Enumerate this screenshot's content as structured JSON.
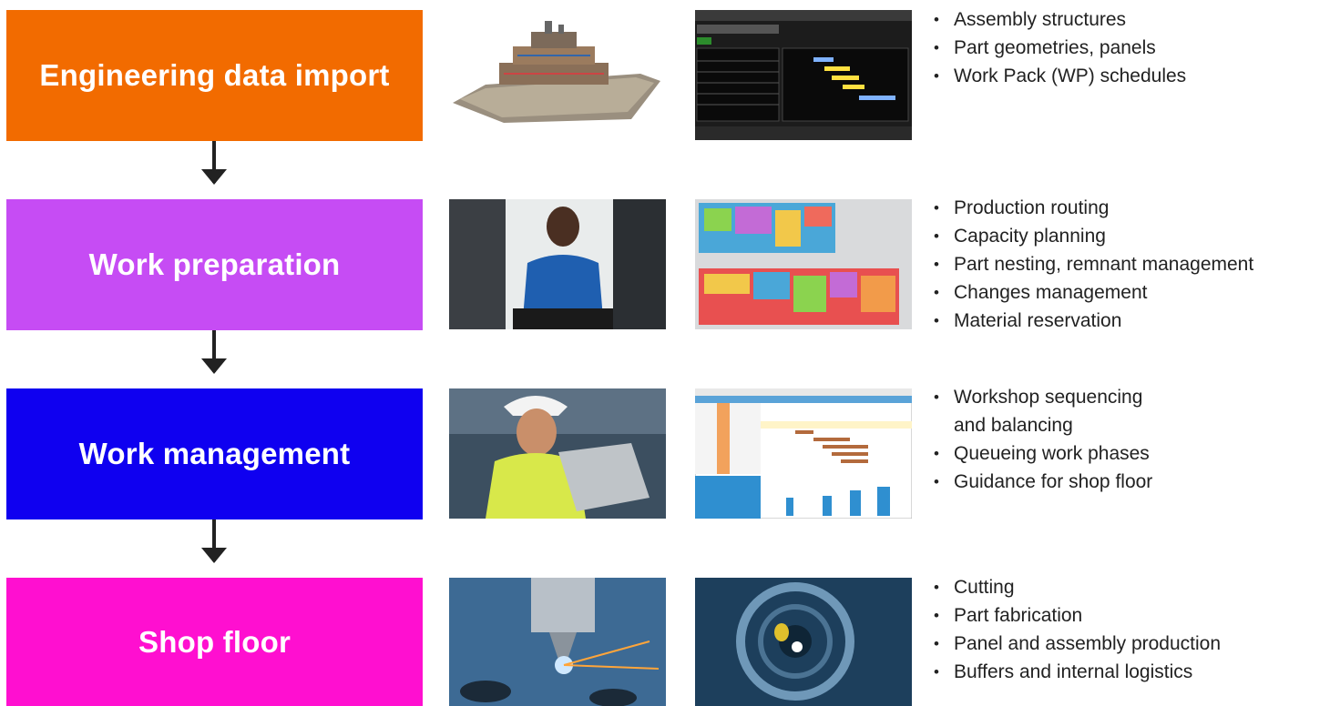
{
  "colors": {
    "stage1": "#f26b00",
    "stage2": "#c64cf4",
    "stage3": "#0f00f0",
    "stage4": "#ff0fd0"
  },
  "stages": [
    {
      "label": "Engineering data import",
      "bullets": [
        "Assembly structures",
        "Part geometries, panels",
        "Work Pack (WP) schedules"
      ]
    },
    {
      "label": "Work preparation",
      "bullets": [
        "Production routing",
        "Capacity planning",
        "Part nesting, remnant management",
        "Changes management",
        "Material reservation"
      ]
    },
    {
      "label": "Work management",
      "bullets": [
        "Workshop sequencing",
        "and balancing",
        "Queueing work phases",
        "Guidance for shop floor"
      ]
    },
    {
      "label": "Shop floor",
      "bullets": [
        "Cutting",
        "Part fabrication",
        "Panel and assembly production",
        "Buffers and internal logistics"
      ]
    }
  ]
}
